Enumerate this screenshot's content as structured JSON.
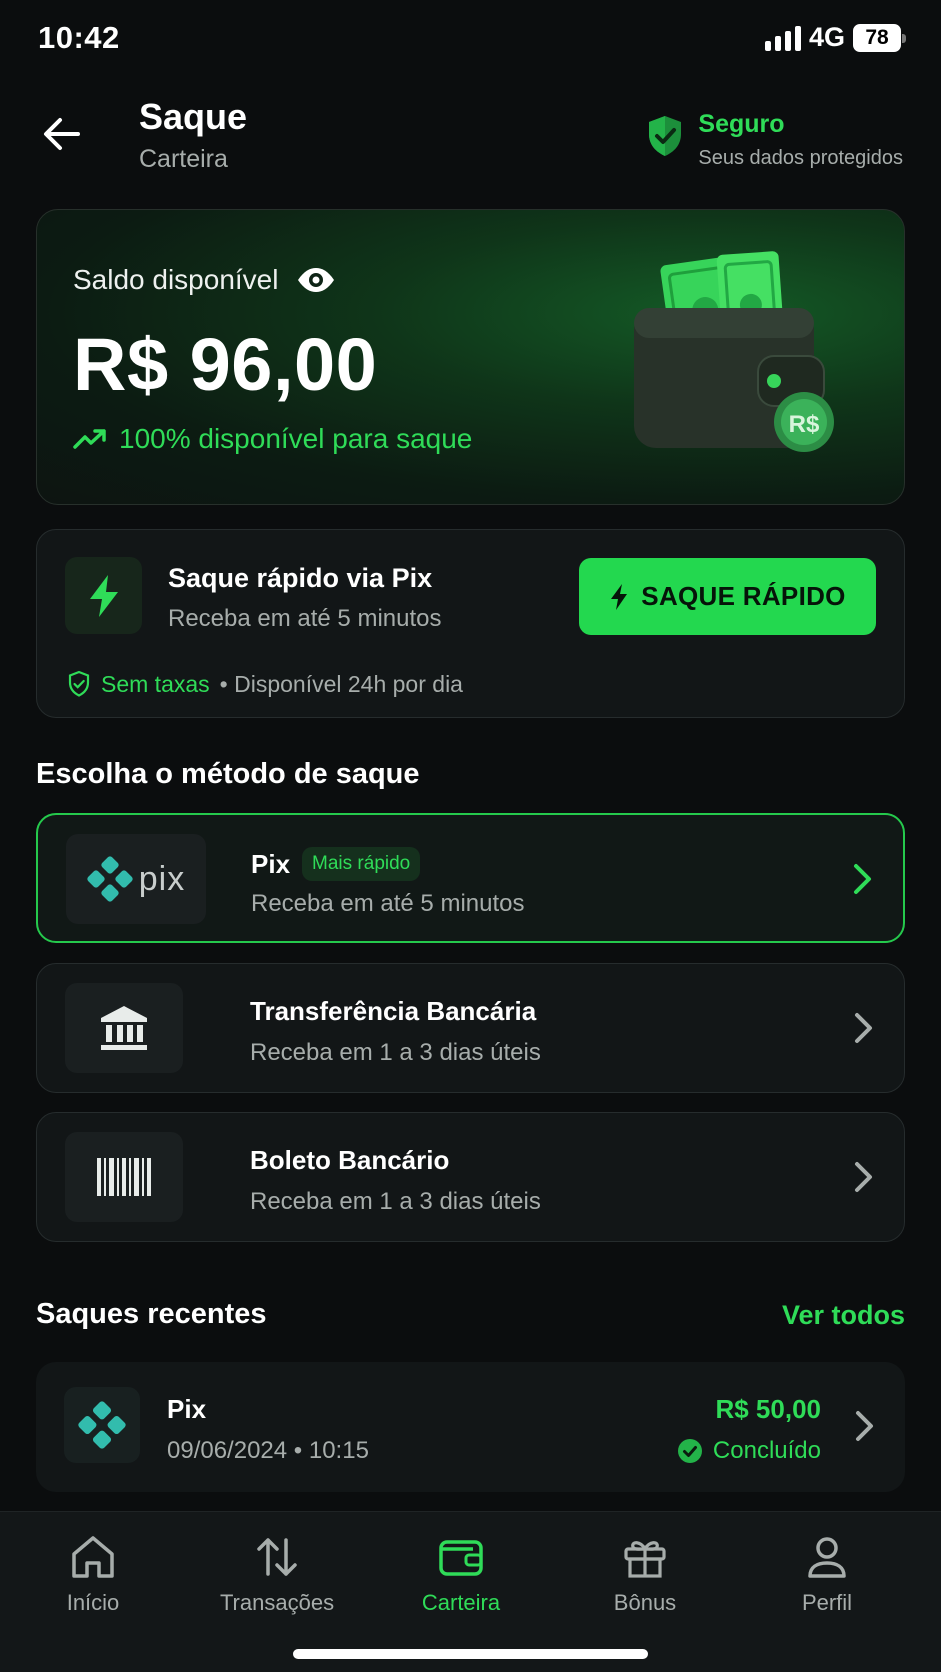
{
  "status_bar": {
    "time": "10:42",
    "network": "4G",
    "battery": "78"
  },
  "header": {
    "title": "Saque",
    "subtitle": "Carteira",
    "secure_title": "Seguro",
    "secure_subtitle": "Seus dados protegidos"
  },
  "balance": {
    "label": "Saldo disponível",
    "amount": "R$ 96,00",
    "availability": "100% disponível para saque",
    "coin_text": "R$"
  },
  "quick": {
    "title": "Saque rápido via Pix",
    "subtitle": "Receba em até 5 minutos",
    "button": "SAQUE RÁPIDO",
    "no_fees": "Sem taxas",
    "availability": "• Disponível 24h por dia"
  },
  "methods_title": "Escolha o método de saque",
  "methods": [
    {
      "logo_text": "pix",
      "title": "Pix",
      "badge": "Mais rápido",
      "subtitle": "Receba em até 5 minutos",
      "selected": true
    },
    {
      "title": "Transferência Bancária",
      "subtitle": "Receba em 1 a 3 dias úteis",
      "selected": false
    },
    {
      "title": "Boleto Bancário",
      "subtitle": "Receba em 1 a 3 dias úteis",
      "selected": false
    }
  ],
  "recent": {
    "title": "Saques recentes",
    "see_all": "Ver todos",
    "items": [
      {
        "method": "Pix",
        "datetime": "09/06/2024 • 10:15",
        "amount": "R$ 50,00",
        "status": "Concluído"
      }
    ]
  },
  "tabs": [
    {
      "label": "Início",
      "icon": "home-icon"
    },
    {
      "label": "Transações",
      "icon": "arrows-updown-icon"
    },
    {
      "label": "Carteira",
      "icon": "wallet-icon",
      "active": true
    },
    {
      "label": "Bônus",
      "icon": "gift-icon"
    },
    {
      "label": "Perfil",
      "icon": "user-icon"
    }
  ],
  "colors": {
    "accent": "#2fdc58",
    "background": "#0b0d0e",
    "card": "#121617"
  }
}
